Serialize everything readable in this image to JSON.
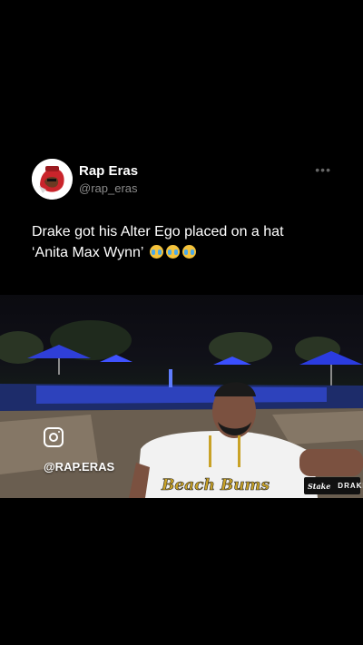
{
  "tweet": {
    "author_name": "Rap Eras",
    "author_handle": "@rap_eras",
    "more_icon": "ellipsis-icon",
    "text_line1": "Drake got his Alter Ego placed on a hat",
    "text_line2": "‘Anita Max Wynn’",
    "emoji": "loudly-crying-face"
  },
  "video": {
    "watermark_handle": "@RAP.ERAS",
    "watermark_icon": "instagram-icon",
    "brand_left": "Stake",
    "brand_right": "DRAKE",
    "jersey_text": "Beach Bums"
  },
  "colors": {
    "background": "#000000",
    "handle_gray": "#8b8b8b",
    "pool_blue": "#3a55ff"
  }
}
